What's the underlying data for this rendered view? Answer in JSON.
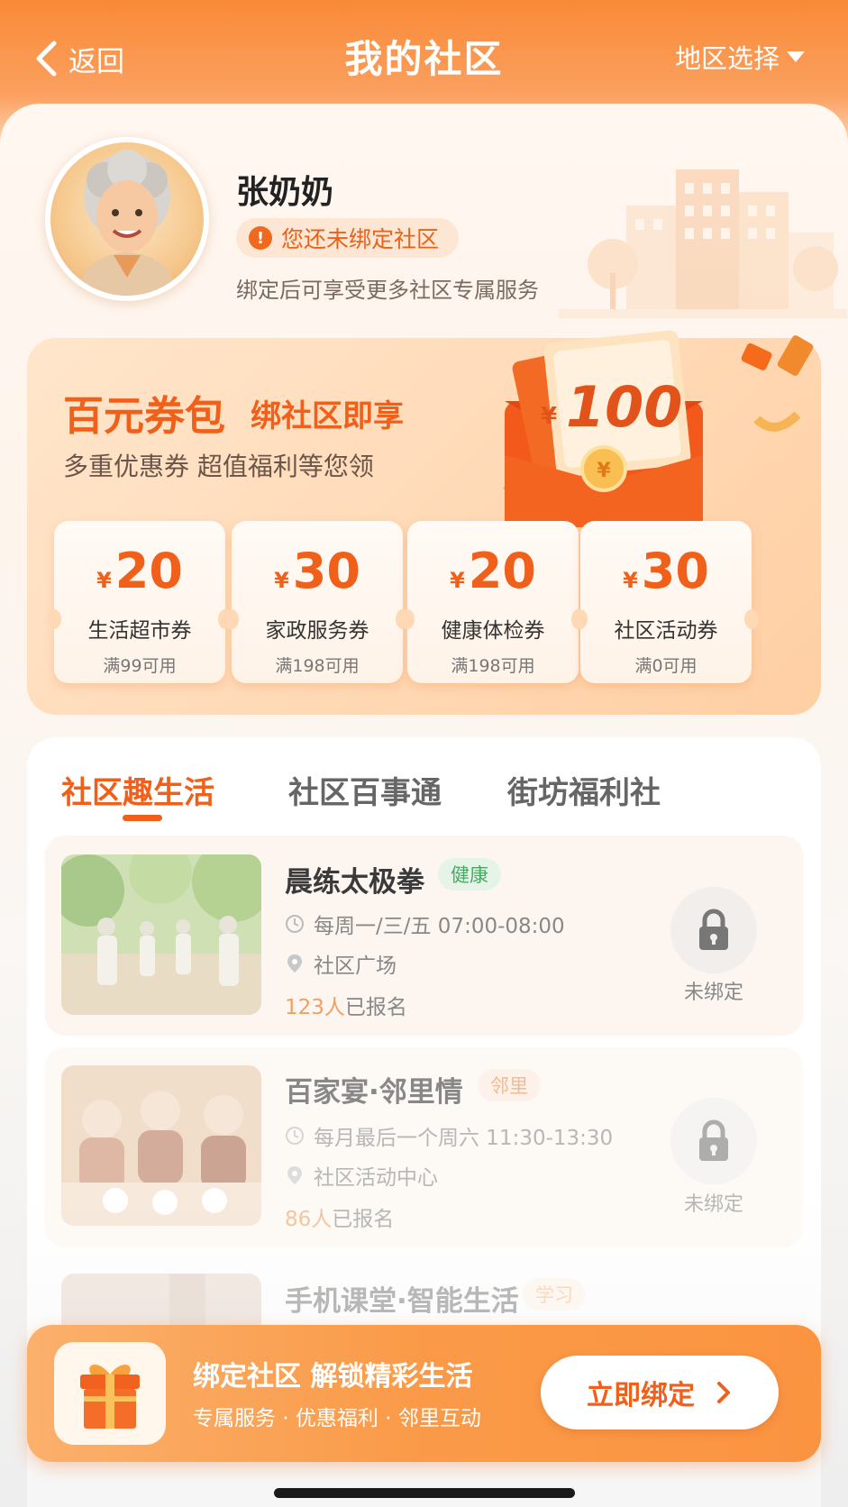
{
  "header": {
    "back_label": "返回",
    "title": "我的社区",
    "region_label": "地区选择"
  },
  "profile": {
    "name": "张奶奶",
    "warning": "您还未绑定社区",
    "hint": "绑定后可享受更多社区专属服务"
  },
  "coupon_pack": {
    "title": "百元券包",
    "subtitle": "绑社区即享",
    "desc": "多重优惠券  超值福利等您领",
    "red_packet_symbol": "¥",
    "red_packet_amount": "100",
    "coins_symbol": "¥",
    "coupons": [
      {
        "symbol": "¥",
        "amount": "20",
        "name": "生活超市券",
        "condition": "满99可用"
      },
      {
        "symbol": "¥",
        "amount": "30",
        "name": "家政服务券",
        "condition": "满198可用"
      },
      {
        "symbol": "¥",
        "amount": "20",
        "name": "健康体检券",
        "condition": "满198可用"
      },
      {
        "symbol": "¥",
        "amount": "30",
        "name": "社区活动券",
        "condition": "满0可用"
      }
    ]
  },
  "tabs": [
    {
      "label": "社区趣生活",
      "active": true
    },
    {
      "label": "社区百事通",
      "active": false
    },
    {
      "label": "街坊福利社",
      "active": false
    }
  ],
  "activities": [
    {
      "title": "晨练太极拳",
      "tag": "健康",
      "tag_color": "#4aa866",
      "tag_bg": "#e6f4e8",
      "time": "每周一/三/五 07:00-08:00",
      "place": "社区广场",
      "count": "123人",
      "count_suffix": "已报名",
      "lock_label": "未绑定"
    },
    {
      "title": "百家宴·邻里情",
      "tag": "邻里",
      "tag_color": "#ef8a4a",
      "tag_bg": "#fdebdc",
      "time": "每月最后一个周六 11:30-13:30",
      "place": "社区活动中心",
      "count": "86人",
      "count_suffix": "已报名",
      "lock_label": "未绑定"
    },
    {
      "title": "手机课堂·智能生活",
      "tag": "学习",
      "tag_color": "#ef9a5a",
      "tag_bg": "#fdeedf"
    }
  ],
  "bottom_bar": {
    "title": "绑定社区  解锁精彩生活",
    "subtitle": "专属服务 · 优惠福利 · 邻里互动",
    "button_label": "立即绑定"
  },
  "colors": {
    "accent": "#f0601a",
    "header": "#f98a37"
  }
}
